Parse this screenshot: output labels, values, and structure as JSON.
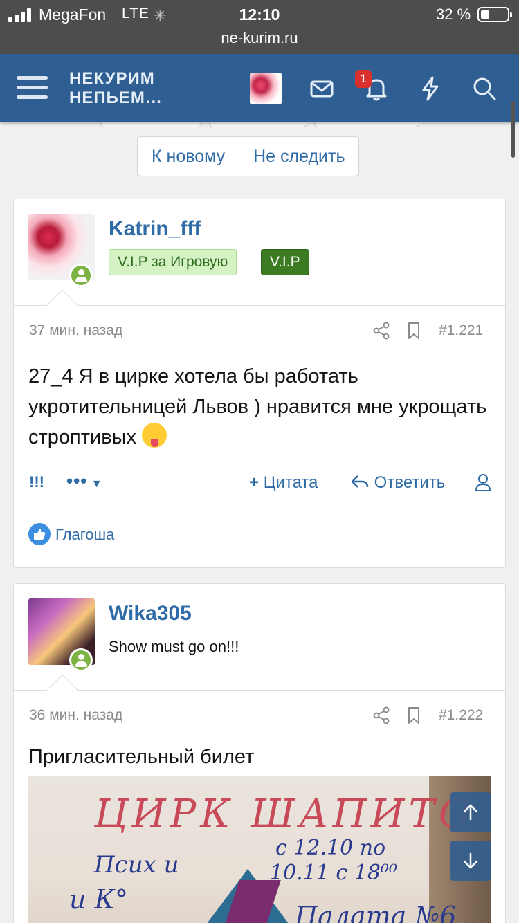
{
  "status_bar": {
    "carrier": "MegaFon",
    "network": "LTE",
    "time": "12:10",
    "battery_pct": "32 %",
    "url": "ne-kurim.ru"
  },
  "navbar": {
    "logo_line1": "НЕКУРИМ",
    "logo_line2": "НЕПЬЕМ…",
    "notification_count": "1",
    "icons": [
      "menu-icon",
      "avatar",
      "mail-icon",
      "bell-icon",
      "lightning-icon",
      "search-icon"
    ]
  },
  "thread_buttons": {
    "new_label": "К новому",
    "unwatch_label": "Не следить"
  },
  "posts": [
    {
      "username": "Katrin_fff",
      "banners": [
        "V.I.P за Игровую",
        "V.I.P"
      ],
      "time": "37 мин. назад",
      "number": "#1.221",
      "text": "27_4 Я в цирке хотела бы работать укротительницей Львов ) нравится мне укрощать строптивых",
      "actions": {
        "report": "!!!",
        "more": "•••",
        "quote": "Цитата",
        "reply": "Ответить"
      },
      "reactions": "Глагоша"
    },
    {
      "username": "Wika305",
      "user_title": "Show must go on!!!",
      "time": "36 мин. назад",
      "number": "#1.222",
      "text": "Пригласительный билет",
      "photo_text": {
        "title": "ЦИРК ШАПИТО",
        "date_from": "с 12.10 по",
        "date_to": "10.11 с 18⁰⁰",
        "left1": "Псих и",
        "left2": "и К°",
        "bottom": "Палата №6"
      }
    }
  ],
  "colors": {
    "navbar": "#2f5f92",
    "link": "#2f6ba6",
    "vip_light": "#d4f2c4",
    "vip_dark": "#3c7a24",
    "online": "#7cb342"
  }
}
